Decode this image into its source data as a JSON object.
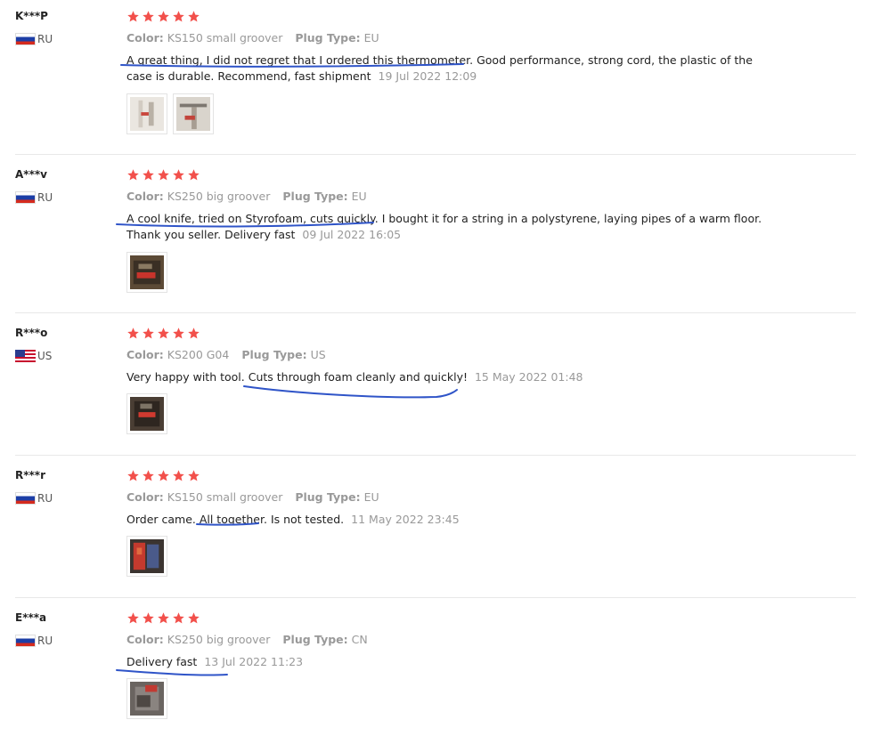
{
  "labels": {
    "color": "Color:",
    "plug_type": "Plug Type:"
  },
  "colors": {
    "star": "#f2504b",
    "underline": "#2f54c8"
  },
  "reviews": [
    {
      "user": "K***P",
      "country": "RU",
      "rating": 5,
      "color": "KS150 small groover",
      "plug_type": "EU",
      "text": "A great thing, I did not regret that I ordered this thermometer. Good performance, strong cord, the plastic of the case is durable. Recommend, fast shipment",
      "date": "19 Jul 2022 12:09",
      "photos": [
        "photo-1",
        "photo-2"
      ]
    },
    {
      "user": "A***v",
      "country": "RU",
      "rating": 5,
      "color": "KS250 big groover",
      "plug_type": "EU",
      "text": "A cool knife, tried on Styrofoam, cuts quickly. I bought it for a string in a polystyrene, laying pipes of a warm floor. Thank you seller. Delivery fast",
      "date": "09 Jul 2022 16:05",
      "photos": [
        "photo-1"
      ]
    },
    {
      "user": "R***o",
      "country": "US",
      "rating": 5,
      "color": "KS200 G04",
      "plug_type": "US",
      "text": "Very happy with tool. Cuts through foam cleanly and quickly!",
      "date": "15 May 2022 01:48",
      "photos": [
        "photo-1"
      ]
    },
    {
      "user": "R***r",
      "country": "RU",
      "rating": 5,
      "color": "KS150 small groover",
      "plug_type": "EU",
      "text": "Order came. All together. Is not tested.",
      "date": "11 May 2022 23:45",
      "photos": [
        "photo-1"
      ]
    },
    {
      "user": "E***a",
      "country": "RU",
      "rating": 5,
      "color": "KS250 big groover",
      "plug_type": "CN",
      "text": "Delivery fast",
      "date": "13 Jul 2022 11:23",
      "photos": [
        "photo-1"
      ]
    }
  ]
}
